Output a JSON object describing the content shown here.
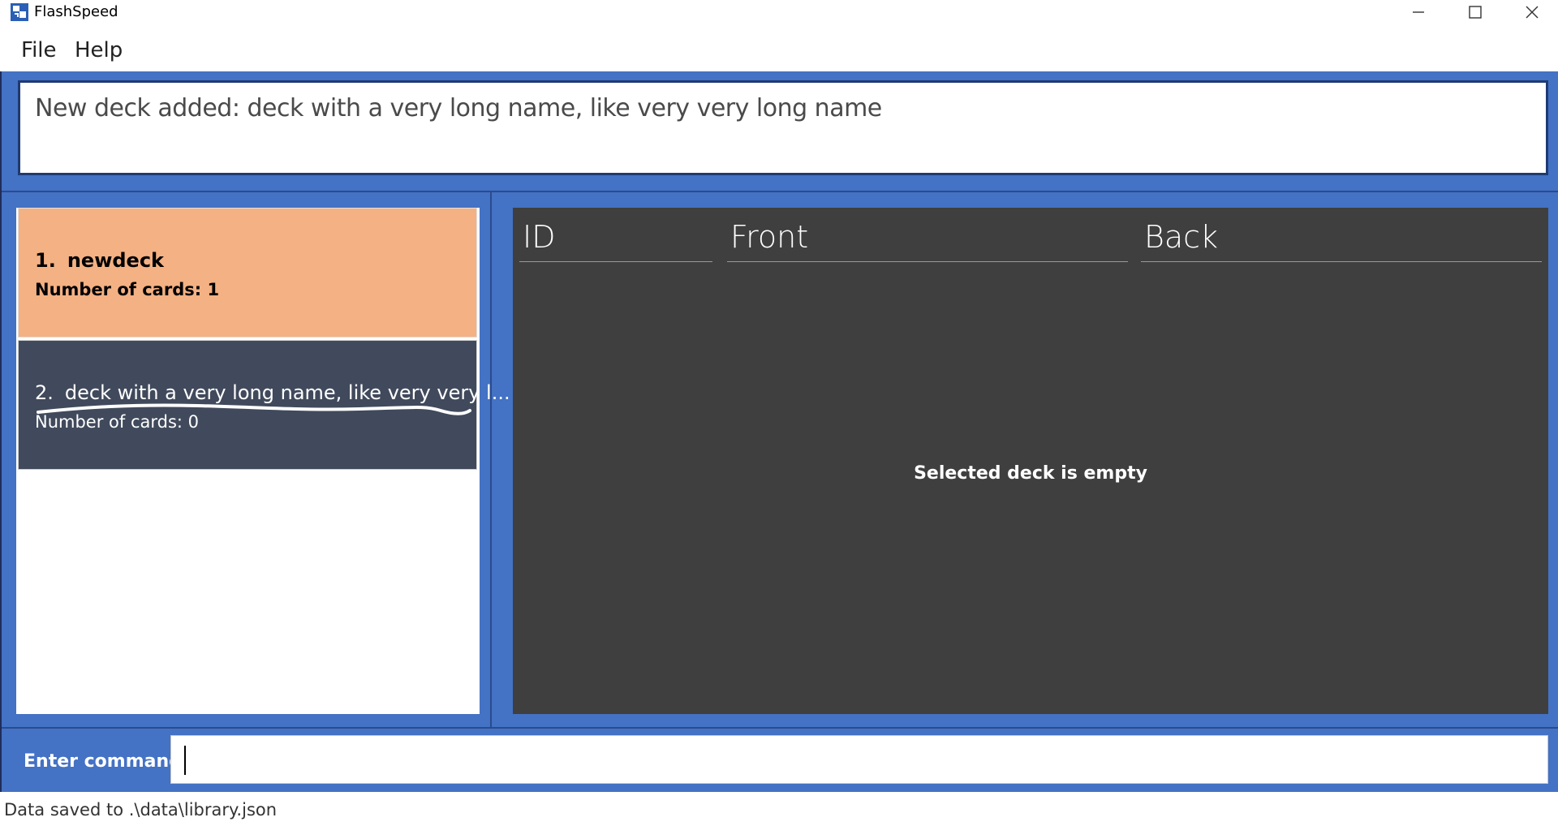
{
  "window": {
    "title": "FlashSpeed",
    "controls": {
      "minimize": "minimize-icon",
      "maximize": "maximize-icon",
      "close": "close-icon"
    }
  },
  "menu": {
    "items": [
      {
        "label": "File"
      },
      {
        "label": "Help"
      }
    ]
  },
  "result": {
    "text": "New deck added: deck with a very long name, like very very long name"
  },
  "decks": [
    {
      "index": "1.",
      "name": "newdeck",
      "count_text": "Number of cards: 1",
      "selected": true
    },
    {
      "index": "2.",
      "name": "deck with a very long name, like very very l...",
      "count_text": "Number of cards: 0",
      "selected": false
    }
  ],
  "cards_table": {
    "columns": [
      "ID",
      "Front",
      "Back"
    ],
    "empty_message": "Selected deck is empty"
  },
  "command": {
    "label": "Enter command:",
    "value": ""
  },
  "status": {
    "text": "Data saved to .\\data\\library.json"
  },
  "colors": {
    "frame": "#4472c4",
    "selected_deck": "#f4b183",
    "deck_dark": "#414a5c",
    "table_bg": "#3f3f3f"
  }
}
